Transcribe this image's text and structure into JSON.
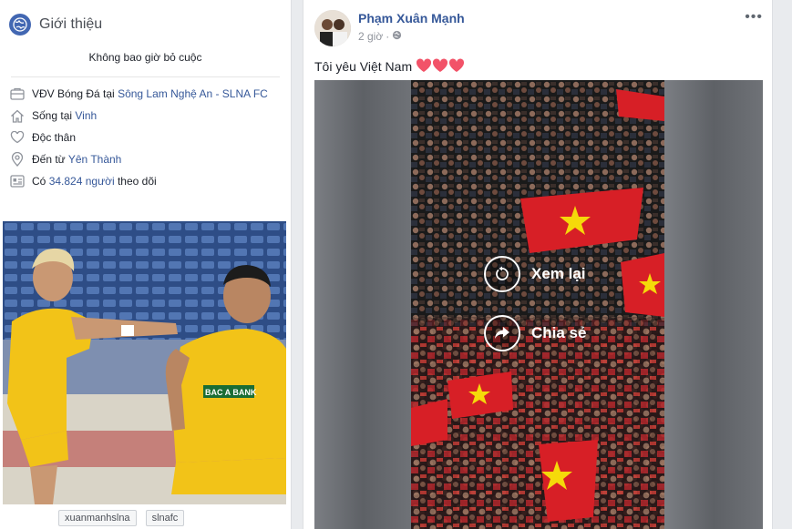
{
  "intro": {
    "title": "Giới thiệu",
    "bio": "Không bao giờ bỏ cuộc",
    "rows": [
      {
        "icon": "briefcase-icon",
        "prefix": "VĐV Bóng Đá tại ",
        "link": "Sông Lam Nghệ An - SLNA FC"
      },
      {
        "icon": "home-icon",
        "prefix": "Sống tại ",
        "link": "Vinh"
      },
      {
        "icon": "heart-icon",
        "prefix": "Độc thân",
        "link": ""
      },
      {
        "icon": "location-pin-icon",
        "prefix": "Đến từ ",
        "link": "Yên Thành"
      },
      {
        "icon": "followers-icon",
        "prefix": "Có ",
        "link": "34.824 người",
        "suffix": " theo dõi"
      }
    ],
    "tags": [
      "xuanmanhslna",
      "slnafc"
    ]
  },
  "post": {
    "author": "Phạm Xuân Mạnh",
    "time": "2 giờ",
    "separator": "·",
    "text": "Tôi yêu Việt Nam",
    "more": "•••",
    "video": {
      "replay_label": "Xem lại",
      "share_label": "Chia sẻ"
    }
  },
  "colors": {
    "link": "#365899",
    "accent": "#4267b2",
    "heart": "#f25268"
  }
}
